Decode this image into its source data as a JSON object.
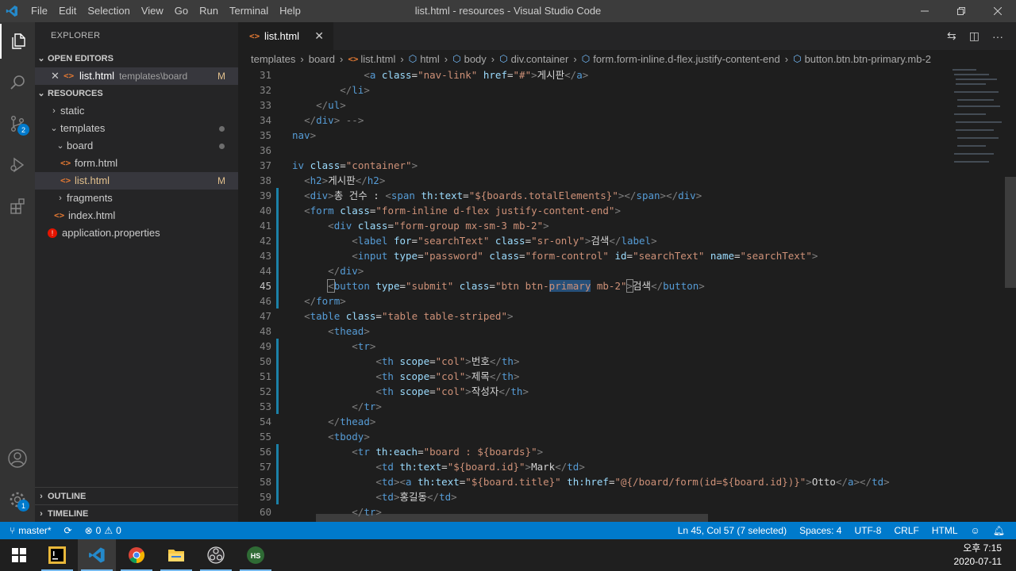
{
  "window": {
    "title": "list.html - resources - Visual Studio Code",
    "menu": [
      "File",
      "Edit",
      "Selection",
      "View",
      "Go",
      "Run",
      "Terminal",
      "Help"
    ]
  },
  "activity": {
    "scm_badge": "2",
    "settings_badge": "1"
  },
  "sidebar": {
    "title": "EXPLORER",
    "open_editors_label": "OPEN EDITORS",
    "open_editor": {
      "name": "list.html",
      "path": "templates\\board",
      "status": "M"
    },
    "root_label": "RESOURCES",
    "tree": [
      {
        "label": "static"
      },
      {
        "label": "templates"
      },
      {
        "label": "board"
      },
      {
        "label": "form.html"
      },
      {
        "label": "list.html",
        "status": "M"
      },
      {
        "label": "fragments"
      },
      {
        "label": "index.html"
      },
      {
        "label": "application.properties"
      }
    ],
    "outline_label": "OUTLINE",
    "timeline_label": "TIMELINE"
  },
  "tabs": [
    {
      "label": "list.html"
    }
  ],
  "breadcrumbs": [
    "templates",
    "board",
    "list.html",
    "html",
    "body",
    "div.container",
    "form.form-inline.d-flex.justify-content-end",
    "button.btn.btn-primary.mb-2"
  ],
  "editor": {
    "line_numbers": [
      "31",
      "32",
      "33",
      "34",
      "35",
      "36",
      "37",
      "38",
      "39",
      "40",
      "41",
      "42",
      "43",
      "44",
      "45",
      "46",
      "47",
      "48",
      "49",
      "50",
      "51",
      "52",
      "53",
      "54",
      "55",
      "56",
      "57",
      "58",
      "59",
      "60"
    ]
  },
  "status": {
    "branch": "master*",
    "errors": "0",
    "warnings": "0",
    "cursor": "Ln 45, Col 57 (7 selected)",
    "spaces": "Spaces: 4",
    "encoding": "UTF-8",
    "eol": "CRLF",
    "language": "HTML"
  },
  "clock": {
    "time": "오후 7:15",
    "date": "2020-07-11"
  },
  "colors": {
    "accent": "#007acc",
    "activity_bar": "#333333",
    "sidebar": "#252526",
    "editor": "#1e1e1e"
  }
}
